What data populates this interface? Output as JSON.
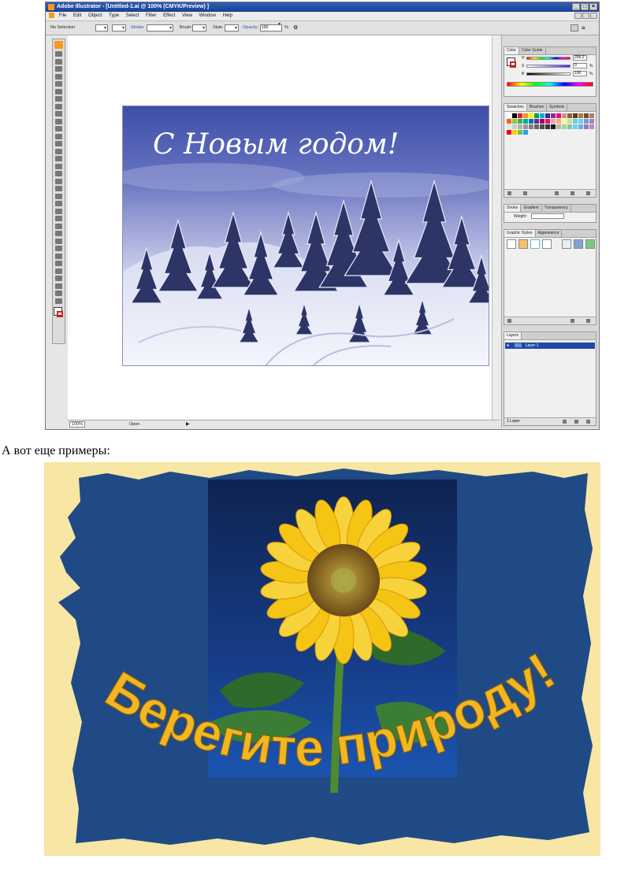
{
  "screenshot": {
    "title": "Adobe Illustrator - [Untitled-1.ai @ 100% (CMYK/Preview) ]",
    "window_buttons": [
      "_",
      "□",
      "×"
    ],
    "menu": [
      "File",
      "Edit",
      "Object",
      "Type",
      "Select",
      "Filter",
      "Effect",
      "View",
      "Window",
      "Help"
    ],
    "control_bar": {
      "selection": "No Selection",
      "stroke_label": "Stroke:",
      "brush_label": "Brush:",
      "style_label": "Style:",
      "opacity_label": "Opacity:",
      "opacity_value": "100",
      "opacity_unit": "%"
    },
    "status_bar": {
      "zoom": "100%",
      "state": "Open"
    },
    "artwork": {
      "greeting": "С Новым годом!"
    },
    "panels": {
      "color_tabs": [
        "Color",
        "Color Guide"
      ],
      "color_channels": [
        {
          "name": "H",
          "value": "256.2",
          "unit": ""
        },
        {
          "name": "S",
          "value": "0",
          "unit": "%"
        },
        {
          "name": "B",
          "value": "100",
          "unit": "%"
        }
      ],
      "swatch_tabs": [
        "Swatches",
        "Brushes",
        "Symbols"
      ],
      "stroke_tabs": [
        "Stroke",
        "Gradient",
        "Transparency"
      ],
      "stroke_weight_label": "Weight:",
      "graphic_styles_tabs": [
        "Graphic Styles",
        "Appearance"
      ],
      "layers_tabs": [
        "Layers"
      ],
      "layer_name": "Layer 1",
      "layers_count": "1 Layer"
    }
  },
  "caption": "А вот еще примеры:",
  "poster": {
    "slogan": "Берегите природу!"
  },
  "colors": {
    "poster_background": "#f7e6a4",
    "poster_blue": "#1f4a86",
    "slogan_yellow": "#f2b622",
    "petal_yellow": "#f6c414",
    "leaf_green": "#2d6a2c",
    "titlebar_blue": "#1f4494"
  }
}
